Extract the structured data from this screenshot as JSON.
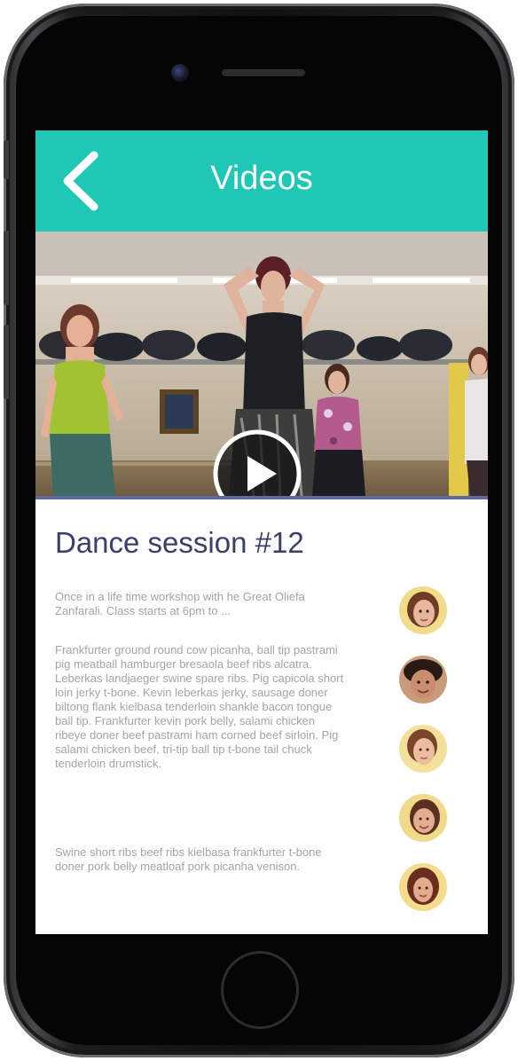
{
  "nav": {
    "title": "Videos",
    "back_icon": "chevron-left-icon",
    "background_color": "#1ec8b4"
  },
  "video": {
    "play_icon": "play-icon",
    "divider_color": "#5d6a9c"
  },
  "session": {
    "title": "Dance session #12",
    "intro": "Once in a life time workshop with he Great Oliefa Zanfarali. Class starts at 6pm to ...",
    "paragraph_1": "Frankfurter ground round cow picanha, ball tip pastrami pig meatball hamburger bresaola beef ribs alcatra. Leberkas landjaeger swine spare ribs. Pig capicola short loin jerky t-bone. Kevin leberkas jerky, sausage doner biltong flank kielbasa tenderloin shankle bacon tongue ball tip. Frankfurter kevin pork belly, salami chicken ribeye doner beef pastrami ham corned beef sirloin. Pig salami chicken beef, tri-tip ball tip t-bone tail chuck tenderloin drumstick.",
    "paragraph_2": "Swine short ribs beef ribs kielbasa frankfurter t-bone doner pork belly meatloaf pork picanha venison.",
    "title_color": "#3a3f67",
    "text_color": "#a3a3ad"
  },
  "participants": [
    {
      "icon": "avatar"
    },
    {
      "icon": "avatar"
    },
    {
      "icon": "avatar"
    },
    {
      "icon": "avatar"
    },
    {
      "icon": "avatar"
    }
  ]
}
